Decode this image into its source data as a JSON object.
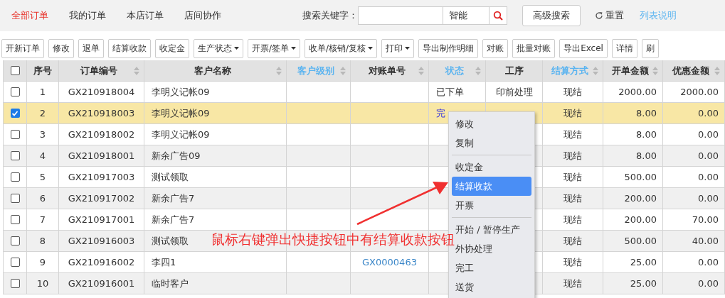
{
  "tabs": [
    {
      "label": "全部订单",
      "selected": true
    },
    {
      "label": "我的订单",
      "selected": false
    },
    {
      "label": "本店订单",
      "selected": false
    },
    {
      "label": "店间协作",
      "selected": false
    }
  ],
  "search": {
    "label": "搜索关键字：",
    "mode": "智能",
    "advanced": "高级搜索",
    "reset": "重置",
    "help_link": "列表说明"
  },
  "toolbar": [
    {
      "label": "开新订单",
      "dropdown": false
    },
    {
      "label": "修改",
      "dropdown": false
    },
    {
      "label": "退单",
      "dropdown": false
    },
    {
      "label": "结算收款",
      "dropdown": false
    },
    {
      "label": "收定金",
      "dropdown": false
    },
    {
      "label": "生产状态",
      "dropdown": true
    },
    {
      "label": "开票/签单",
      "dropdown": true
    },
    {
      "label": "收单/核销/复核",
      "dropdown": true
    },
    {
      "label": "打印",
      "dropdown": true
    },
    {
      "label": "导出制作明细",
      "dropdown": false
    },
    {
      "label": "对账",
      "dropdown": false
    },
    {
      "label": "批量对账",
      "dropdown": false
    },
    {
      "label": "导出Excel",
      "dropdown": false
    },
    {
      "label": "详情",
      "dropdown": false
    },
    {
      "label": "刷",
      "dropdown": false
    }
  ],
  "table": {
    "all_checked": false,
    "columns": [
      {
        "label": "序号",
        "sortable": false,
        "highlighted": false
      },
      {
        "label": "订单编号",
        "sortable": true,
        "highlighted": false
      },
      {
        "label": "客户名称",
        "sortable": true,
        "highlighted": false
      },
      {
        "label": "客户级别",
        "sortable": true,
        "highlighted": true
      },
      {
        "label": "对账单号",
        "sortable": true,
        "highlighted": false
      },
      {
        "label": "状态",
        "sortable": true,
        "highlighted": true
      },
      {
        "label": "工序",
        "sortable": false,
        "highlighted": false
      },
      {
        "label": "结算方式",
        "sortable": true,
        "highlighted": true
      },
      {
        "label": "开单金额",
        "sortable": true,
        "highlighted": false
      },
      {
        "label": "优惠金额",
        "sortable": true,
        "highlighted": false
      }
    ],
    "rows": [
      {
        "checked": false,
        "selected": false,
        "no": "1",
        "order_no": "GX210918004",
        "customer": "李明义记帐09",
        "status": {
          "text": "已下单",
          "kind": "plain"
        },
        "process": "印前处理",
        "settlement": "现结",
        "amount": "2000.00",
        "discount": "2000.00"
      },
      {
        "checked": true,
        "selected": true,
        "no": "2",
        "order_no": "GX210918003",
        "customer": "李明义记帐09",
        "status": {
          "text": "完",
          "kind": "link"
        },
        "settlement": "现结",
        "amount": "8.00",
        "discount": "0.00"
      },
      {
        "checked": false,
        "selected": false,
        "no": "3",
        "order_no": "GX210918002",
        "customer": "李明义记帐09",
        "settlement": "现结",
        "amount": "8.00",
        "discount": "0.00"
      },
      {
        "checked": false,
        "selected": false,
        "no": "4",
        "order_no": "GX210918001",
        "customer": "新余广告09",
        "settlement": "现结",
        "amount": "8.00",
        "discount": "0.00"
      },
      {
        "checked": false,
        "selected": false,
        "no": "5",
        "order_no": "GX210917003",
        "customer": "测试领取",
        "settlement": "现结",
        "amount": "500.00",
        "discount": "0.00"
      },
      {
        "checked": false,
        "selected": false,
        "no": "6",
        "order_no": "GX210917002",
        "customer": "新余广告7",
        "settlement": "现结",
        "amount": "200.00",
        "discount": "0.00"
      },
      {
        "checked": false,
        "selected": false,
        "no": "7",
        "order_no": "GX210917001",
        "customer": "新余广告7",
        "settlement": "现结",
        "amount": "200.00",
        "discount": "70.00"
      },
      {
        "checked": false,
        "selected": false,
        "no": "8",
        "order_no": "GX210916003",
        "customer": "测试领取",
        "settlement": "现结",
        "amount": "500.00",
        "discount": "40.00"
      },
      {
        "checked": false,
        "selected": false,
        "no": "9",
        "order_no": "GX210916002",
        "customer": "李四1",
        "account_no": "GX0000463",
        "settlement": "现结",
        "amount": "25.00",
        "discount": "0.00"
      },
      {
        "checked": false,
        "selected": false,
        "no": "10",
        "order_no": "GX210916001",
        "customer": "临时客户",
        "settlement": "现结",
        "amount": "25.00",
        "discount": "0.00"
      }
    ]
  },
  "context_menu": {
    "groups": [
      {
        "items": [
          {
            "label": "修改",
            "selected": false
          },
          {
            "label": "复制",
            "selected": false
          }
        ]
      },
      {
        "items": [
          {
            "label": "收定金",
            "selected": false
          },
          {
            "label": "结算收款",
            "selected": true
          },
          {
            "label": "开票",
            "selected": false
          }
        ]
      },
      {
        "items": [
          {
            "label": "开始 / 暂停生产",
            "selected": false
          },
          {
            "label": "外协处理",
            "selected": false
          },
          {
            "label": "完工",
            "selected": false
          },
          {
            "label": "送货",
            "selected": false
          }
        ]
      }
    ]
  },
  "annotation": "鼠标右键弹出快捷按钮中有结算收款按钮"
}
